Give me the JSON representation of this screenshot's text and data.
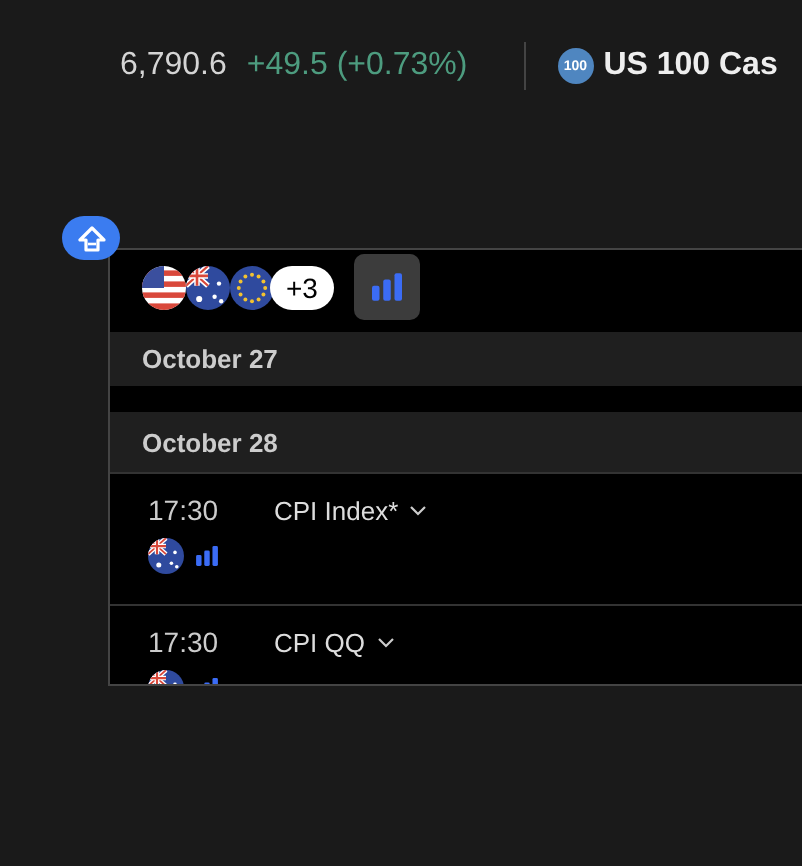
{
  "ticker": {
    "price": "6,790.6",
    "change": "+49.5 (+0.73%)",
    "next_badge": "100",
    "next_name": "US 100 Cas"
  },
  "filters": {
    "flags": [
      {
        "kind": "us"
      },
      {
        "kind": "au"
      },
      {
        "kind": "eu"
      }
    ],
    "more": "+3"
  },
  "days": [
    {
      "date": "October 27"
    },
    {
      "date": "October 28",
      "events": [
        {
          "time": "17:30",
          "name": "CPI Index*",
          "kind": "au"
        },
        {
          "time": "17:30",
          "name": "CPI QQ",
          "kind": "au"
        }
      ]
    }
  ]
}
